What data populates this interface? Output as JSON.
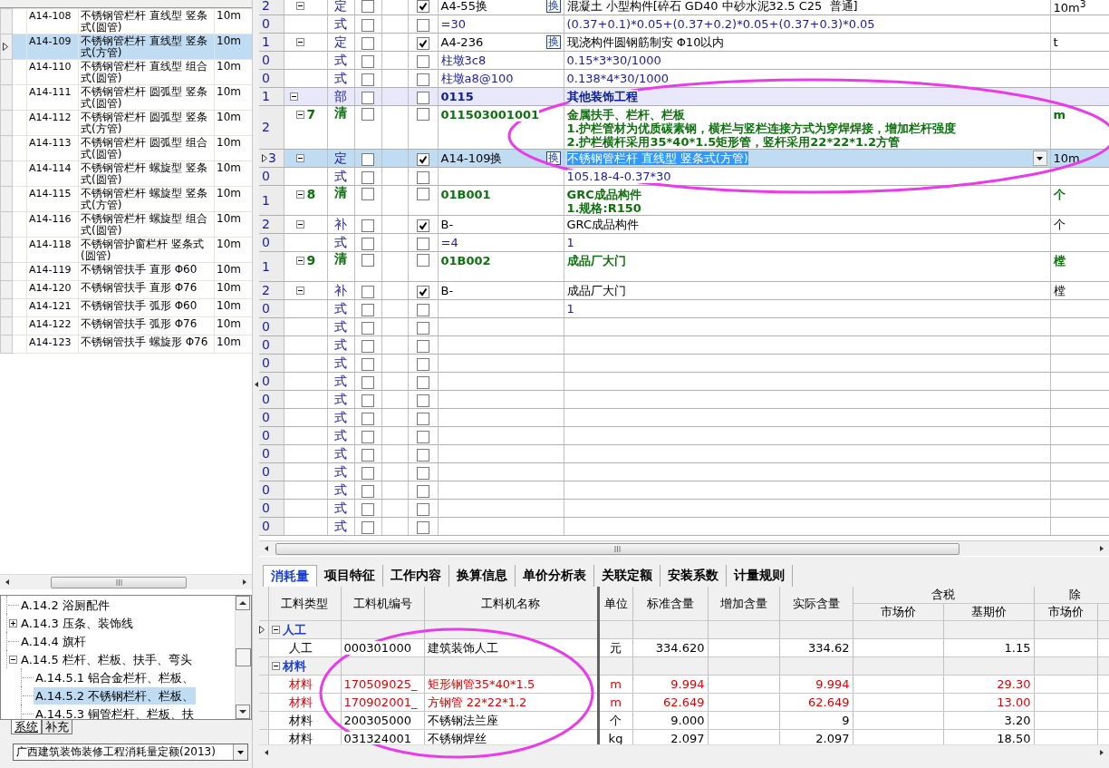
{
  "quota_table": {
    "rows": [
      {
        "code": "A14-108",
        "name": "不锈钢管栏杆 直线型 竖条式(圆管)",
        "unit": "10m",
        "selected": false
      },
      {
        "code": "A14-109",
        "name": "不锈钢管栏杆 直线型 竖条式(方管)",
        "unit": "10m",
        "selected": true
      },
      {
        "code": "A14-110",
        "name": "不锈钢管栏杆 直线型 组合式(圆管)",
        "unit": "10m",
        "selected": false
      },
      {
        "code": "A14-111",
        "name": "不锈钢管栏杆 圆弧型 竖条式(圆管)",
        "unit": "10m",
        "selected": false
      },
      {
        "code": "A14-112",
        "name": "不锈钢管栏杆 圆弧型 竖条式(方管)",
        "unit": "10m",
        "selected": false
      },
      {
        "code": "A14-113",
        "name": "不锈钢管栏杆 圆弧型 组合式(圆管)",
        "unit": "10m",
        "selected": false
      },
      {
        "code": "A14-114",
        "name": "不锈钢管栏杆 螺旋型 竖条式(圆管)",
        "unit": "10m",
        "selected": false
      },
      {
        "code": "A14-115",
        "name": "不锈钢管栏杆 螺旋型 竖条式(方管)",
        "unit": "10m",
        "selected": false
      },
      {
        "code": "A14-116",
        "name": "不锈钢管栏杆 螺旋型 组合式(圆管)",
        "unit": "10m",
        "selected": false
      },
      {
        "code": "A14-118",
        "name": "不锈钢管护窗栏杆 竖条式(圆管)",
        "unit": "10m",
        "selected": false
      },
      {
        "code": "A14-119",
        "name": "不锈钢管扶手 直形 Φ60",
        "unit": "10m",
        "selected": false
      },
      {
        "code": "A14-120",
        "name": "不锈钢管扶手 直形 Φ76",
        "unit": "10m",
        "selected": false
      },
      {
        "code": "A14-121",
        "name": "不锈钢管扶手 弧形 Φ60",
        "unit": "10m",
        "selected": false
      },
      {
        "code": "A14-122",
        "name": "不锈钢管扶手 弧形 Φ76",
        "unit": "10m",
        "selected": false
      },
      {
        "code": "A14-123",
        "name": "不锈钢管扶手 螺旋形 Φ76",
        "unit": "10m",
        "selected": false
      }
    ]
  },
  "chapter_tree": {
    "items": [
      {
        "label": "A.14.2 浴厕配件",
        "selected": false
      },
      {
        "label": "A.14.3 压条、装饰线",
        "expanded": false,
        "selected": false
      },
      {
        "label": "A.14.4 旗杆",
        "selected": false
      },
      {
        "label": "A.14.5 栏杆、栏板、扶手、弯头",
        "expanded": true,
        "selected": false,
        "children": [
          {
            "label": "A.14.5.1 铝合金栏杆、栏板、",
            "selected": false
          },
          {
            "label": "A.14.5.2 不锈钢栏杆、栏板、",
            "selected": true
          },
          {
            "label": "A.14.5.3 铜管栏杆、栏板、扶",
            "selected": false
          }
        ]
      }
    ]
  },
  "library_tabs": [
    {
      "label": "系统",
      "selected": true
    },
    {
      "label": "补充",
      "selected": false
    }
  ],
  "library_select": {
    "value": "广西建筑装饰装修工程消耗量定额(2013)"
  },
  "main_grid": {
    "rows": [
      {
        "level": "2",
        "kind": "quota",
        "type": "定",
        "check_a": false,
        "check_b": true,
        "code": "A4-55换",
        "badge": "换",
        "name": "混凝土 小型构件[碎石 GD40 中砂水泥32.5 C25  普通]",
        "unit": "10m$^{3}$",
        "current": false,
        "selected": false
      },
      {
        "level": "0",
        "kind": "formula",
        "type": "式",
        "check_a": false,
        "check_b": false,
        "code": "=30",
        "name": "(0.37+0.1)*0.05+(0.37+0.2)*0.05+(0.37+0.3)*0.05",
        "current": false,
        "selected": false
      },
      {
        "level": "1",
        "kind": "quota",
        "type": "定",
        "check_a": false,
        "check_b": true,
        "code": "A4-236",
        "badge": "换",
        "name": "现浇构件圆钢筋制安 Φ10以内",
        "unit": "t",
        "current": false,
        "selected": false
      },
      {
        "level": "0",
        "kind": "formula",
        "type": "式",
        "check_a": false,
        "check_b": false,
        "code": "柱墩3c8",
        "name": "0.15*3*30/1000",
        "current": false,
        "selected": false
      },
      {
        "level": "0",
        "kind": "formula",
        "type": "式",
        "check_a": false,
        "check_b": false,
        "code": "柱墩a8@100",
        "name": "0.138*4*30/1000",
        "current": false,
        "selected": false
      },
      {
        "level": "1",
        "kind": "division",
        "type": "部",
        "check_a": false,
        "check_b": false,
        "code": "0115",
        "name": "其他装饰工程",
        "current": false,
        "selected": false
      },
      {
        "level": "2",
        "kind": "bill",
        "seq": "7",
        "type": "清",
        "check_a": false,
        "check_b": false,
        "code": "011503001001",
        "name": "金属扶手、栏杆、栏板\n1.护栏管材为优质碳素钢，横栏与竖栏连接方式为穿焊焊接，增加栏杆强度\n2.护栏横杆采用35*40*1.5矩形管，竖杆采用22*22*1.2方管",
        "unit": "m",
        "current": false,
        "selected": false
      },
      {
        "level": "3",
        "kind": "quota",
        "type": "定",
        "check_a": false,
        "check_b": true,
        "code": "A14-109换",
        "badge": "换",
        "name": "不锈钢管栏杆 直线型 竖条式(方管)",
        "unit": "10m",
        "current": true,
        "selected": true,
        "editing": true
      },
      {
        "level": "0",
        "kind": "formula",
        "type": "式",
        "check_a": false,
        "check_b": false,
        "name": "105.18-4-0.37*30",
        "current": false,
        "selected": false
      },
      {
        "level": "1",
        "kind": "bill",
        "seq": "8",
        "type": "清",
        "check_a": false,
        "check_b": false,
        "code": "01B001",
        "name": "GRC成品构件\n1.规格:R150",
        "unit": "个",
        "current": false,
        "selected": false
      },
      {
        "level": "2",
        "kind": "supplement",
        "type": "补",
        "check_a": false,
        "check_b": true,
        "code": "B-",
        "name": "GRC成品构件",
        "unit": "个",
        "current": false,
        "selected": false
      },
      {
        "level": "0",
        "kind": "formula",
        "type": "式",
        "check_a": false,
        "check_b": false,
        "code": "=4",
        "name": "1",
        "current": false,
        "selected": false
      },
      {
        "level": "1",
        "kind": "bill",
        "seq": "9",
        "type": "清",
        "check_a": false,
        "check_b": false,
        "code": "01B002",
        "name": "成品厂大门",
        "unit": "樘",
        "current": false,
        "selected": false
      },
      {
        "level": "2",
        "kind": "supplement",
        "type": "补",
        "check_a": false,
        "check_b": true,
        "code": "B-",
        "name": "成品厂大门",
        "unit": "樘",
        "current": false,
        "selected": false
      },
      {
        "level": "0",
        "kind": "formula",
        "type": "式",
        "check_a": false,
        "check_b": false,
        "name": "1",
        "current": false,
        "selected": false
      },
      {
        "level": "0",
        "kind": "formula",
        "type": "式",
        "check_a": false,
        "check_b": false,
        "current": false,
        "selected": false
      },
      {
        "level": "0",
        "kind": "formula",
        "type": "式",
        "check_a": false,
        "check_b": false,
        "current": false,
        "selected": false
      },
      {
        "level": "0",
        "kind": "formula",
        "type": "式",
        "check_a": false,
        "check_b": false,
        "current": false,
        "selected": false
      },
      {
        "level": "0",
        "kind": "formula",
        "type": "式",
        "check_a": false,
        "check_b": false,
        "current": false,
        "selected": false
      },
      {
        "level": "0",
        "kind": "formula",
        "type": "式",
        "check_a": false,
        "check_b": false,
        "current": false,
        "selected": false
      },
      {
        "level": "0",
        "kind": "formula",
        "type": "式",
        "check_a": false,
        "check_b": false,
        "current": false,
        "selected": false
      },
      {
        "level": "0",
        "kind": "formula",
        "type": "式",
        "check_a": false,
        "check_b": false,
        "current": false,
        "selected": false
      },
      {
        "level": "0",
        "kind": "formula",
        "type": "式",
        "check_a": false,
        "check_b": false,
        "current": false,
        "selected": false
      },
      {
        "level": "0",
        "kind": "formula",
        "type": "式",
        "check_a": false,
        "check_b": false,
        "current": false,
        "selected": false
      },
      {
        "level": "0",
        "kind": "formula",
        "type": "式",
        "check_a": false,
        "check_b": false,
        "current": false,
        "selected": false
      },
      {
        "level": "0",
        "kind": "formula",
        "type": "式",
        "check_a": false,
        "check_b": false,
        "current": false,
        "selected": false
      },
      {
        "level": "0",
        "kind": "formula",
        "type": "式",
        "check_a": false,
        "check_b": false,
        "current": false,
        "selected": false
      }
    ]
  },
  "detail_tabs": [
    {
      "label": "消耗量",
      "selected": true
    },
    {
      "label": "项目特征",
      "selected": false
    },
    {
      "label": "工作内容",
      "selected": false
    },
    {
      "label": "换算信息",
      "selected": false
    },
    {
      "label": "单价分析表",
      "selected": false
    },
    {
      "label": "关联定额",
      "selected": false
    },
    {
      "label": "安装系数",
      "selected": false
    },
    {
      "label": "计量规则",
      "selected": false
    }
  ],
  "resource_table": {
    "columns": [
      "工料类型",
      "工料机编号",
      "工料机名称",
      "单位",
      "标准含量",
      "增加含量",
      "实际含量"
    ],
    "groups": [
      {
        "label": "含税",
        "columns": [
          "市场价",
          "基期价"
        ]
      },
      {
        "label": "除",
        "columns": [
          "市场价"
        ]
      }
    ],
    "rows": [
      {
        "kind": "group",
        "label": "人工",
        "expanded": true,
        "current": true
      },
      {
        "kind": "item",
        "flagged": false,
        "type": "人工",
        "code": "000301000",
        "name": "建筑装饰人工",
        "unit": "元",
        "standard": "334.620",
        "actual": "334.62",
        "base_price": "1.15"
      },
      {
        "kind": "group",
        "label": "材料",
        "expanded": true,
        "current": false
      },
      {
        "kind": "item",
        "flagged": true,
        "type": "材料",
        "code": "170509025_",
        "name": "矩形钢管35*40*1.5",
        "unit": "m",
        "standard": "9.994",
        "actual": "9.994",
        "base_price": "29.30"
      },
      {
        "kind": "item",
        "flagged": true,
        "type": "材料",
        "code": "170902001_",
        "name": "方钢管 22*22*1.2",
        "unit": "m",
        "standard": "62.649",
        "actual": "62.649",
        "base_price": "13.00"
      },
      {
        "kind": "item",
        "flagged": false,
        "type": "材料",
        "code": "200305000",
        "name": "不锈钢法兰座",
        "unit": "个",
        "standard": "9.000",
        "actual": "9",
        "base_price": "3.20"
      },
      {
        "kind": "item",
        "flagged": false,
        "type": "材料",
        "code": "031324001",
        "name": "不锈钢焊丝",
        "unit": "kg",
        "standard": "2.097",
        "actual": "2.097",
        "base_price": "18.50"
      }
    ]
  },
  "annotations": [
    {
      "kind": "ellipse"
    },
    {
      "kind": "ellipse"
    }
  ]
}
